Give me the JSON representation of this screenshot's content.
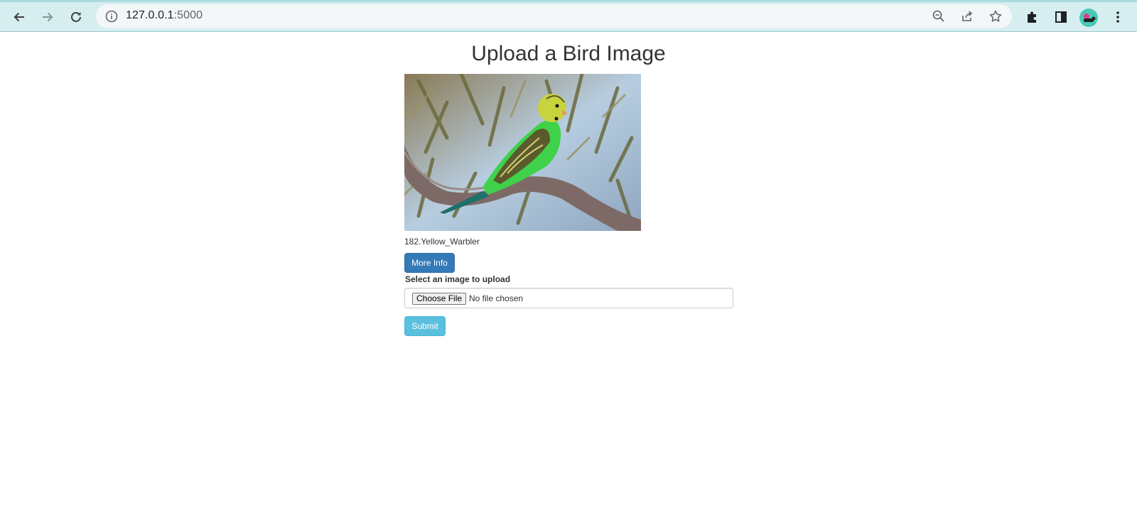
{
  "browser": {
    "url_host": "127.0.0.1",
    "url_port": ":5000",
    "icons": [
      "back-arrow-icon",
      "forward-arrow-icon",
      "reload-icon",
      "info-icon",
      "zoom-out-icon",
      "share-icon",
      "bookmark-star-icon",
      "extensions-puzzle-icon",
      "side-panel-icon",
      "profile-avatar",
      "kebab-menu-icon"
    ]
  },
  "page": {
    "title": "Upload a Bird Image",
    "image_alt": "budgerigar on branch",
    "prediction": "182.Yellow_Warbler",
    "more_info_label": "More Info",
    "upload_label": "Select an image to upload",
    "choose_file_label": "Choose File",
    "no_file_text": "No file chosen",
    "submit_label": "Submit"
  },
  "colors": {
    "primary": "#337ab7",
    "info": "#5bc0de",
    "chrome": "#d6eef0"
  }
}
